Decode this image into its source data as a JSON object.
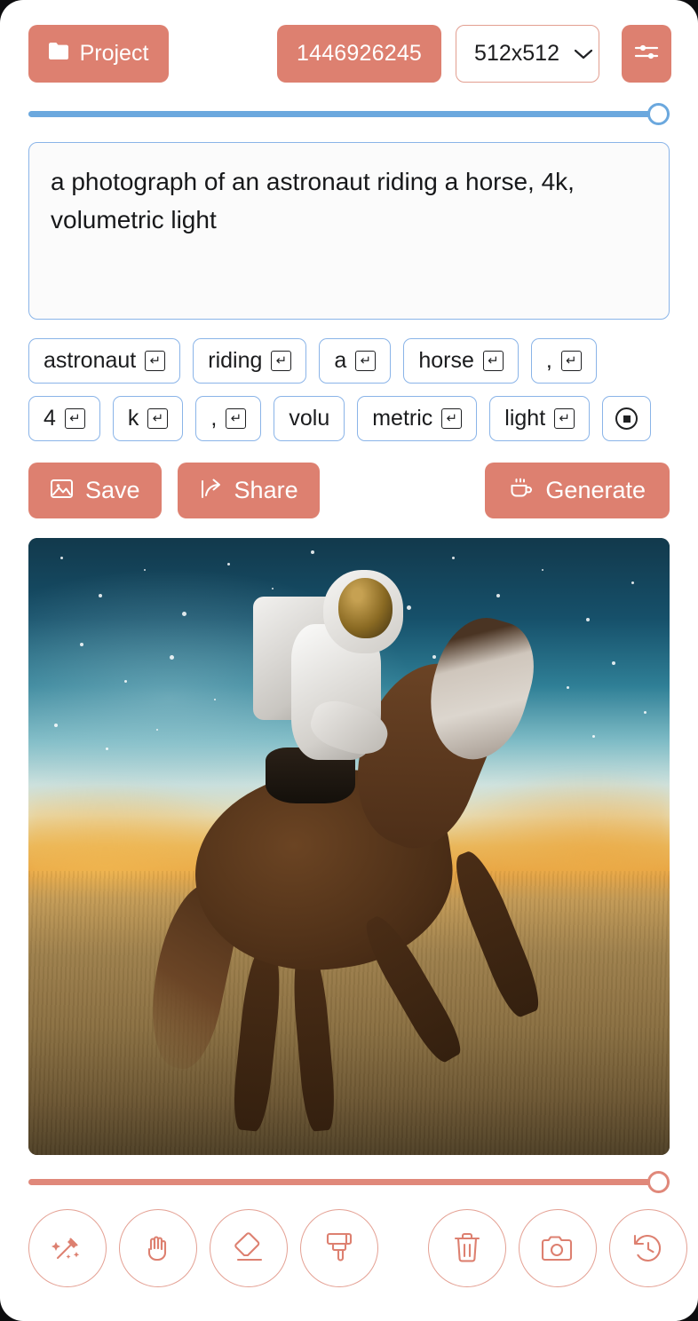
{
  "theme": {
    "coral": "#dd8070",
    "coral_border": "#e4a093",
    "chip_border": "#8ab4e8",
    "slider_blue": "#6ba8de",
    "slider_coral": "#e0887a",
    "card_bg": "#ffffff",
    "page_bg": "#0d0d0f"
  },
  "topbar": {
    "project_label": "Project",
    "project_icon": "folder-icon",
    "seed_value": "1446926245",
    "size_value": "512x512",
    "size_caret_icon": "chevron-down-icon",
    "settings_icon": "sliders-icon"
  },
  "top_slider": {
    "name": "strength-slider",
    "value": 100,
    "min": 0,
    "max": 100,
    "color": "#6ba8de"
  },
  "prompt": {
    "value": "a photograph of an astronaut riding a horse, 4k, volumetric light",
    "placeholder": "Enter a prompt"
  },
  "tokens": [
    {
      "label": "astronaut",
      "glyph": "return-key-icon"
    },
    {
      "label": "riding",
      "glyph": "return-key-icon"
    },
    {
      "label": "a",
      "glyph": "return-key-icon"
    },
    {
      "label": "horse",
      "glyph": "return-key-icon"
    },
    {
      "label": ",",
      "glyph": "return-key-icon"
    },
    {
      "label": "4",
      "glyph": "return-key-icon"
    },
    {
      "label": "k",
      "glyph": "return-key-icon"
    },
    {
      "label": ",",
      "glyph": "return-key-icon"
    },
    {
      "label": "volu",
      "glyph": ""
    },
    {
      "label": "metric",
      "glyph": "return-key-icon"
    },
    {
      "label": "light",
      "glyph": "return-key-icon"
    },
    {
      "label": "",
      "glyph": "circle-square-icon"
    }
  ],
  "actions": {
    "save_label": "Save",
    "save_icon": "image-icon",
    "share_label": "Share",
    "share_icon": "share-arrow-icon",
    "generate_label": "Generate",
    "generate_icon": "coffee-cup-icon"
  },
  "canvas": {
    "alt": "a photograph of an astronaut riding a horse, 4k, volumetric light",
    "subject": "astronaut-riding-horse"
  },
  "bottom_slider": {
    "name": "brush-size-slider",
    "value": 100,
    "min": 0,
    "max": 100,
    "color": "#e0887a"
  },
  "toolbar": {
    "tools_left": [
      {
        "name": "magic-wand-tool",
        "icon": "magic-wand-icon"
      },
      {
        "name": "pan-tool",
        "icon": "hand-icon"
      },
      {
        "name": "eraser-tool",
        "icon": "eraser-icon"
      },
      {
        "name": "brush-tool",
        "icon": "paint-brush-icon"
      }
    ],
    "tools_right": [
      {
        "name": "delete-button",
        "icon": "trash-icon"
      },
      {
        "name": "snapshot-button",
        "icon": "camera-icon"
      },
      {
        "name": "history-button",
        "icon": "history-clock-icon"
      }
    ]
  }
}
